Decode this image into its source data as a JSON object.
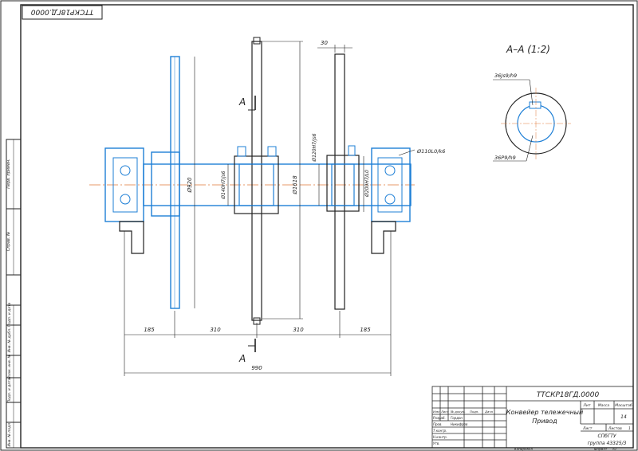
{
  "stamp_code": "ТТСКР18ГД.0000",
  "section": {
    "title": "А–А (1:2)",
    "fit_top": "36Js9/h9",
    "fit_bottom": "36P9/h9"
  },
  "cut_mark": "А",
  "dims": {
    "d30": "30",
    "d920": "Ø920",
    "d1618": "Ø1618",
    "d140": "Ø140H7/js6",
    "d120": "Ø120H7/js6",
    "d200": "Ø200H7/L0",
    "d110": "Ø110L0/k6",
    "l185a": "185",
    "l310a": "310",
    "l310b": "310",
    "l185b": "185",
    "l990": "990"
  },
  "title_block": {
    "code": "ТТСКР18ГД.0000",
    "name_line1": "Конвейер тележечный",
    "name_line2": "Привод",
    "h_lit": "Лит",
    "h_mass": "Масса",
    "h_scale": "Масштаб",
    "scale": "14",
    "sheet": "Лист",
    "sheets": "Листов",
    "sheets_n": "1",
    "org1": "СПбГТУ",
    "org2": "группа 43325/3",
    "rows": [
      "Изм",
      "Лист",
      "№ докум.",
      "Подп.",
      "Дата"
    ],
    "r_razrab": "Разраб.",
    "r_prov": "Пров.",
    "r_tkontr": "Т.контр.",
    "r_nkontr": "Н.контр.",
    "r_utv": "Утв.",
    "n_razrab": "Гордон",
    "n_prov": "Никифров",
    "copy": "Копировал",
    "format": "Формат",
    "format_v": "А2"
  },
  "side_fields": [
    "Перв. примен.",
    "Справ. №",
    "Подп. и дата",
    "Инв. № дубл.",
    "Взам. инв. №",
    "Подп. и дата",
    "Инв. № подл."
  ]
}
